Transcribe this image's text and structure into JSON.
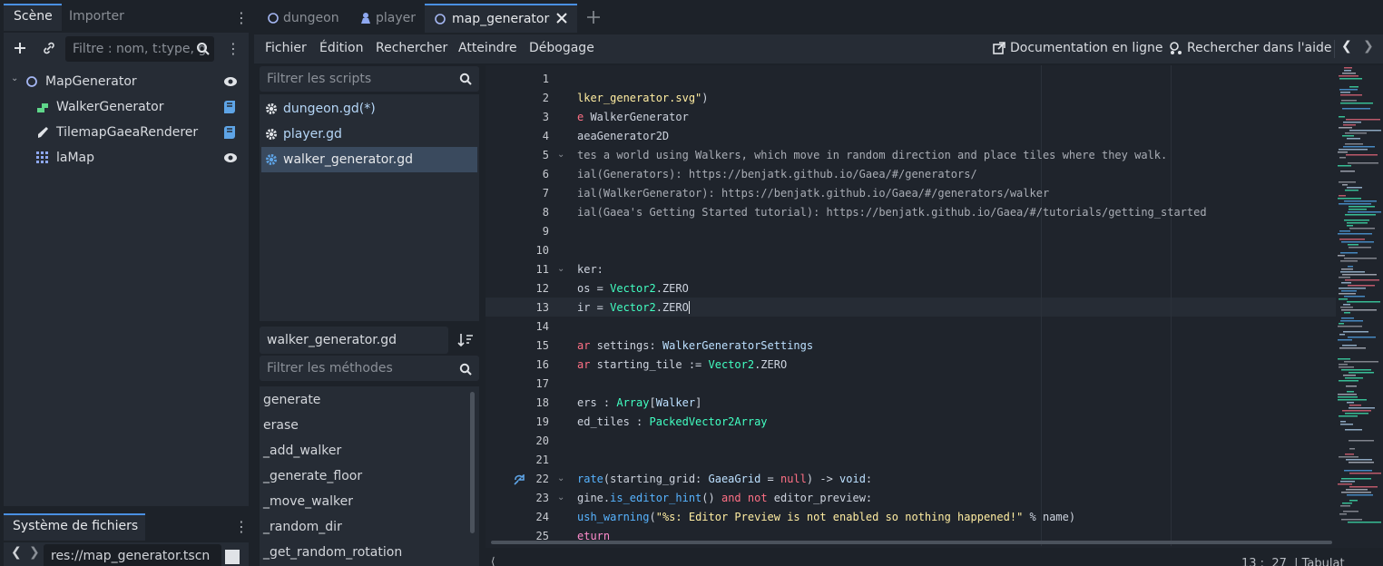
{
  "scene_dock": {
    "tabs": [
      "Scène",
      "Importer"
    ],
    "filter_placeholder": "Filtre : nom, t:type, g",
    "nodes": [
      {
        "name": "MapGenerator",
        "icon": "node-circle-icon"
      },
      {
        "name": "WalkerGenerator",
        "icon": "walker-node-icon"
      },
      {
        "name": "TilemapGaeaRenderer",
        "icon": "brush-icon"
      },
      {
        "name": "laMap",
        "icon": "tilemap-grid-icon"
      }
    ]
  },
  "filesystem_dock": {
    "title": "Système de fichiers",
    "path": "res://map_generator.tscn"
  },
  "file_tabs": [
    {
      "label": "dungeon",
      "icon": "circle-icon"
    },
    {
      "label": "player",
      "icon": "player-icon"
    },
    {
      "label": "map_generator",
      "icon": "circle-icon",
      "active": true
    }
  ],
  "menu": {
    "items": [
      "Fichier",
      "Édition",
      "Rechercher",
      "Atteindre",
      "Débogage"
    ],
    "doc_online": "Documentation en ligne",
    "search_help": "Rechercher dans l'aide"
  },
  "scripts": {
    "filter_placeholder": "Filtrer les scripts",
    "items": [
      {
        "name": "dungeon.gd(*)",
        "selected": false
      },
      {
        "name": "player.gd",
        "selected": false
      },
      {
        "name": "walker_generator.gd",
        "selected": true
      }
    ],
    "current": "walker_generator.gd",
    "methods_filter_placeholder": "Filtrer les méthodes",
    "methods": [
      "generate",
      "erase",
      "_add_walker",
      "_generate_floor",
      "_move_walker",
      "_random_dir",
      "_get_random_rotation"
    ]
  },
  "editor": {
    "line_numbers": [
      "1",
      "2",
      "3",
      "4",
      "5",
      "6",
      "7",
      "8",
      "9",
      "10",
      "11",
      "12",
      "13",
      "14",
      "15",
      "16",
      "17",
      "18",
      "19",
      "20",
      "21",
      "22",
      "23",
      "24",
      "25"
    ],
    "status": "13 :  27  | Tabulat",
    "colors": {
      "keyword": "#ff7085",
      "type": "#42ffc2",
      "function": "#57b3ff",
      "string": "#ffeda1",
      "comment": "#a9adb5",
      "accent": "#4a90e2"
    }
  }
}
